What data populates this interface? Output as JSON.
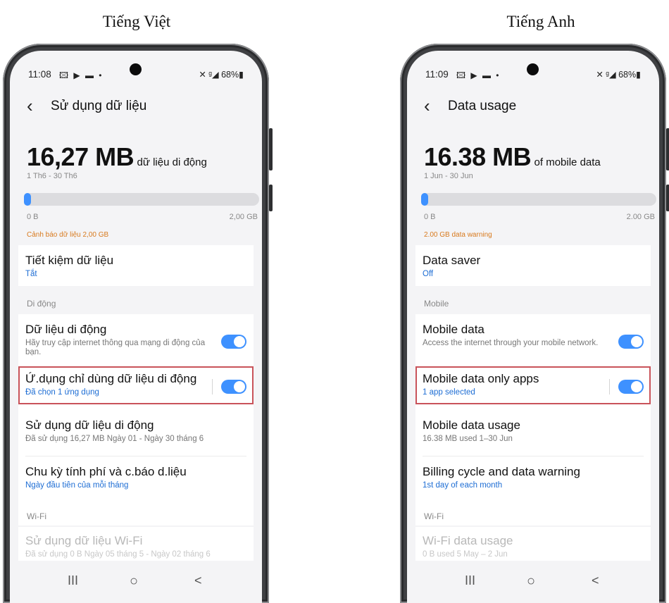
{
  "captions": {
    "left": "Tiếng Việt",
    "right": "Tiếng Anh"
  },
  "colors": {
    "accent": "#3e91ff",
    "warning": "#d87a1e",
    "highlight": "#c9535a",
    "link": "#1d6dd4"
  },
  "vi": {
    "status": {
      "time": "11:08",
      "icons": "🖾 ▶ ▬ •",
      "right": "✕ ᵍ◢ 68%▮"
    },
    "title": "Sử dụng dữ liệu",
    "usage": {
      "amount": "16,27 MB",
      "unit": "dữ liệu di động",
      "range": "1 Th6 - 30 Th6",
      "min": "0 B",
      "max": "2,00 GB",
      "warning": "Cảnh báo dữ liệu 2,00 GB",
      "fill_fraction": 0.008
    },
    "data_saver": {
      "title": "Tiết kiệm dữ liệu",
      "value": "Tắt"
    },
    "section_mobile": "Di động",
    "mobile_data": {
      "title": "Dữ liệu di động",
      "desc": "Hãy truy cập internet thông qua mạng di động của bạn.",
      "on": true
    },
    "mobile_only_apps": {
      "title": "Ứ.dụng chỉ dùng dữ liệu di động",
      "value": "Đã chọn 1 ứng dụng",
      "on": true
    },
    "mobile_usage": {
      "title": "Sử dụng dữ liệu di động",
      "desc": "Đã sử dụng 16,27 MB Ngày 01 - Ngày 30 tháng 6"
    },
    "billing": {
      "title": "Chu kỳ tính phí và c.báo d.liệu",
      "value": "Ngày đầu tiên của mỗi tháng"
    },
    "section_wifi": "Wi-Fi",
    "wifi_usage": {
      "title": "Sử dụng dữ liệu Wi-Fi",
      "desc": "Đã sử dụng 0 B Ngày 05 tháng 5 - Ngày 02 tháng 6"
    },
    "nav": {
      "recent": "III",
      "home": "○",
      "back": "<"
    }
  },
  "en": {
    "status": {
      "time": "11:09",
      "icons": "🖾 ▶ ▬ •",
      "right": "✕ ᵍ◢ 68%▮"
    },
    "title": "Data usage",
    "usage": {
      "amount": "16.38 MB",
      "unit": "of mobile data",
      "range": "1 Jun - 30 Jun",
      "min": "0 B",
      "max": "2.00 GB",
      "warning": "2.00 GB data warning",
      "fill_fraction": 0.008
    },
    "data_saver": {
      "title": "Data saver",
      "value": "Off"
    },
    "section_mobile": "Mobile",
    "mobile_data": {
      "title": "Mobile data",
      "desc": "Access the internet through your mobile network.",
      "on": true
    },
    "mobile_only_apps": {
      "title": "Mobile data only apps",
      "value": "1 app selected",
      "on": true
    },
    "mobile_usage": {
      "title": "Mobile data usage",
      "desc": "16.38 MB used 1–30 Jun"
    },
    "billing": {
      "title": "Billing cycle and data warning",
      "value": "1st day of each month"
    },
    "section_wifi": "Wi-Fi",
    "wifi_usage": {
      "title": "Wi-Fi data usage",
      "desc": "0 B used 5 May – 2 Jun"
    },
    "nav": {
      "recent": "III",
      "home": "○",
      "back": "<"
    }
  }
}
